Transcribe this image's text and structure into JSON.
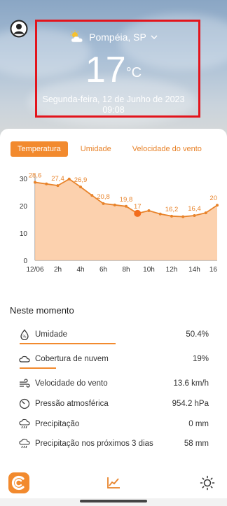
{
  "header": {
    "location": "Pompéia, SP",
    "temperature": "17",
    "temperature_unit": "°C",
    "date": "Segunda-feira, 12 de Junho de 2023",
    "time": "09:08",
    "weather_icon": "partly-sunny-icon"
  },
  "tabs": [
    {
      "label": "Temperatura",
      "active": true
    },
    {
      "label": "Umidade",
      "active": false
    },
    {
      "label": "Velocidade do vento",
      "active": false
    }
  ],
  "chart_data": {
    "type": "area",
    "x_labels": [
      "12/06",
      "2h",
      "4h",
      "6h",
      "8h",
      "10h",
      "12h",
      "14h",
      "16"
    ],
    "y_ticks": [
      "0",
      "10",
      "20",
      "30"
    ],
    "ylim": [
      0,
      30
    ],
    "current_index": 9,
    "series": [
      {
        "values": [
          28.6,
          28.0,
          27.4,
          29.8,
          26.9,
          23.8,
          20.8,
          20.3,
          19.8,
          17.2,
          18.2,
          17.0,
          16.2,
          16.0,
          16.4,
          17.4,
          20.2
        ]
      }
    ],
    "data_labels": [
      {
        "index": 0,
        "text": "28,6"
      },
      {
        "index": 2,
        "text": "27,4"
      },
      {
        "index": 4,
        "text": "26,9"
      },
      {
        "index": 6,
        "text": "20,8"
      },
      {
        "index": 8,
        "text": "19,8"
      },
      {
        "index": 9,
        "text": "17"
      },
      {
        "index": 12,
        "text": "16,2"
      },
      {
        "index": 14,
        "text": "16,4"
      },
      {
        "index": 16,
        "text": "20"
      }
    ],
    "colors": {
      "line": "#e8832a",
      "fill": "#fbc9a0",
      "current": "#f26d1d"
    }
  },
  "now": {
    "title": "Neste momento",
    "items": [
      {
        "label": "Umidade",
        "value": "50.4%",
        "icon": "humidity-drop-icon",
        "bar_fraction": 0.504
      },
      {
        "label": "Cobertura de nuvem",
        "value": "19%",
        "icon": "cloud-icon",
        "bar_fraction": 0.19
      },
      {
        "label": "Velocidade do vento",
        "value": "13.6 km/h",
        "icon": "wind-icon"
      },
      {
        "label": "Pressão atmosférica",
        "value": "954.2 hPa",
        "icon": "gauge-icon"
      },
      {
        "label": "Precipitação",
        "value": "0 mm",
        "icon": "rain-cloud-icon"
      },
      {
        "label": "Precipitação nos próximos 3 dias",
        "value": "58 mm",
        "icon": "rain-cloud-icon"
      }
    ]
  },
  "nav": {
    "items": [
      "app-logo-icon",
      "chart-icon",
      "sun-icon"
    ],
    "accent": "#f28a2e"
  }
}
